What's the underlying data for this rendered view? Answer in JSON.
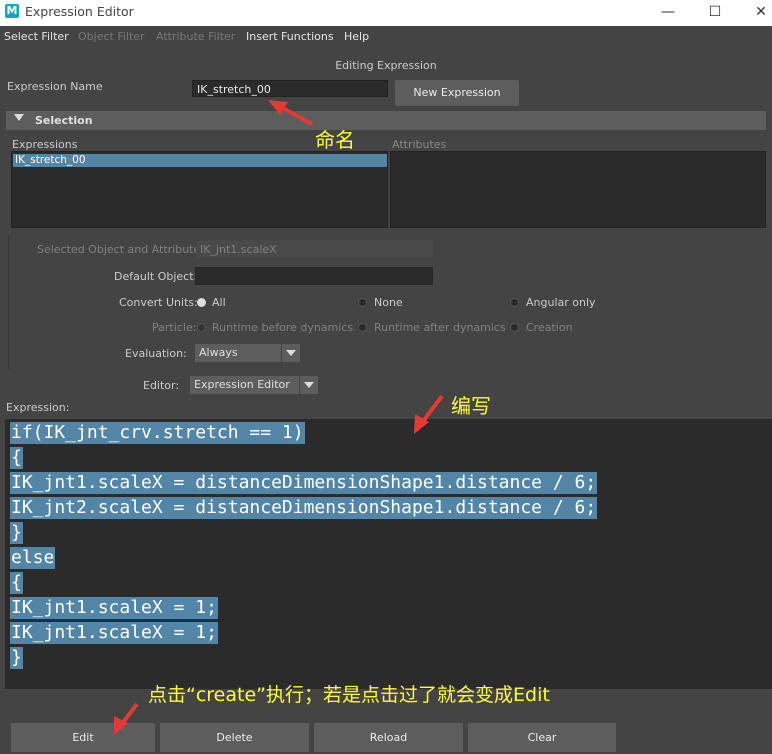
{
  "window": {
    "title": "Expression Editor",
    "app_icon_letter": "M",
    "minimize": "—",
    "maximize": "☐",
    "close": "✕"
  },
  "menu": {
    "items": [
      "Select Filter",
      "Object Filter",
      "Attribute Filter",
      "Insert Functions",
      "Help"
    ]
  },
  "header": {
    "editing_label": "Editing Expression"
  },
  "expression_name": {
    "label": "Expression Name",
    "value": "IK_stretch_00",
    "new_button": "New Expression"
  },
  "selection": {
    "title": "Selection",
    "expressions_label": "Expressions",
    "attributes_label": "Attributes",
    "expressions": [
      "IK_stretch_00"
    ]
  },
  "props": {
    "selected_obj_label": "Selected Object and Attribute:",
    "selected_obj_value": "IK_jnt1.scaleX",
    "default_obj_label": "Default Object:",
    "convert_units_label": "Convert Units:",
    "convert_units_options": [
      "All",
      "None",
      "Angular only"
    ],
    "particle_label": "Particle:",
    "particle_options": [
      "Runtime before dynamics",
      "Runtime after dynamics",
      "Creation"
    ],
    "evaluation_label": "Evaluation:",
    "evaluation_value": "Always",
    "editor_label": "Editor:",
    "editor_value": "Expression Editor",
    "expression_label": "Expression:"
  },
  "code": {
    "lines": [
      "if(IK_jnt_crv.stretch == 1)",
      "{",
      "IK_jnt1.scaleX = distanceDimensionShape1.distance / 6;",
      "IK_jnt2.scaleX = distanceDimensionShape1.distance / 6;",
      "}",
      "else",
      "{",
      "IK_jnt1.scaleX = 1;",
      "IK_jnt1.scaleX = 1;",
      "}"
    ]
  },
  "buttons": {
    "edit": "Edit",
    "delete": "Delete",
    "reload": "Reload",
    "clear": "Clear"
  },
  "annotations": {
    "name": "命名",
    "write": "编写",
    "create_note": "点击“create”执行；若是点击过了就会变成Edit",
    "color": "#ffff33"
  }
}
